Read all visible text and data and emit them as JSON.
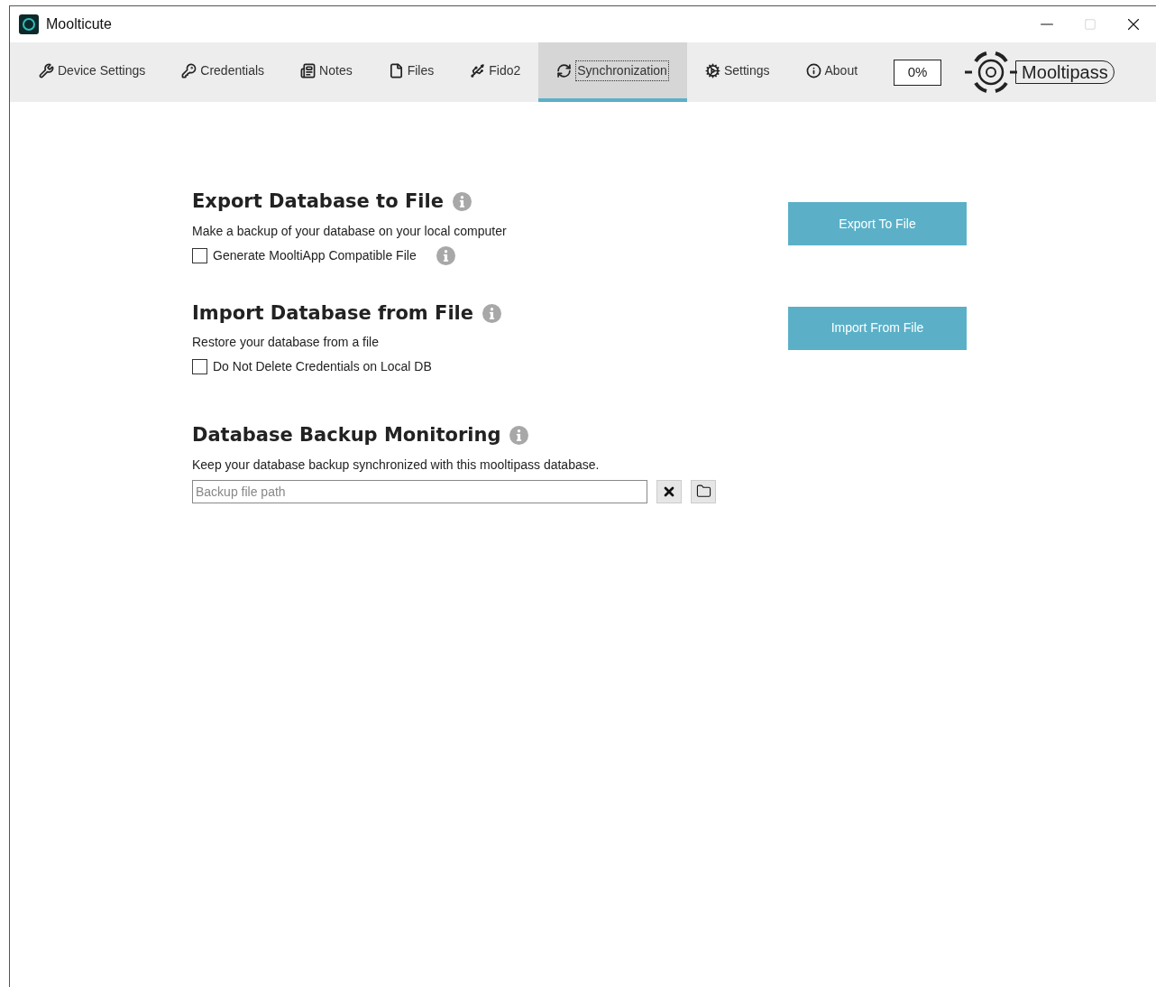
{
  "window": {
    "title": "Moolticute"
  },
  "tabs": [
    {
      "label": "Device Settings",
      "selected": false
    },
    {
      "label": "Credentials",
      "selected": false
    },
    {
      "label": "Notes",
      "selected": false
    },
    {
      "label": "Files",
      "selected": false
    },
    {
      "label": "Fido2",
      "selected": false
    },
    {
      "label": "Synchronization",
      "selected": true
    },
    {
      "label": "Settings",
      "selected": false
    },
    {
      "label": "About",
      "selected": false
    }
  ],
  "progress": "0%",
  "logo": {
    "text": "Mooltipass"
  },
  "sections": [
    {
      "title": "Export Database to File",
      "description": "Make a backup of your database on your local computer",
      "checkbox": {
        "label": "Generate MooltiApp Compatible File",
        "checked": false,
        "info": true
      },
      "button": "Export To File"
    },
    {
      "title": "Import Database from File",
      "description": "Restore your database from a file",
      "checkbox": {
        "label": "Do Not Delete Credentials on Local DB",
        "checked": false,
        "info": false
      },
      "button": "Import From File"
    }
  ],
  "monitoring": {
    "title": "Database Backup Monitoring",
    "description": "Keep your database backup synchronized with this mooltipass database.",
    "field": {
      "placeholder": "Backup file path"
    }
  }
}
